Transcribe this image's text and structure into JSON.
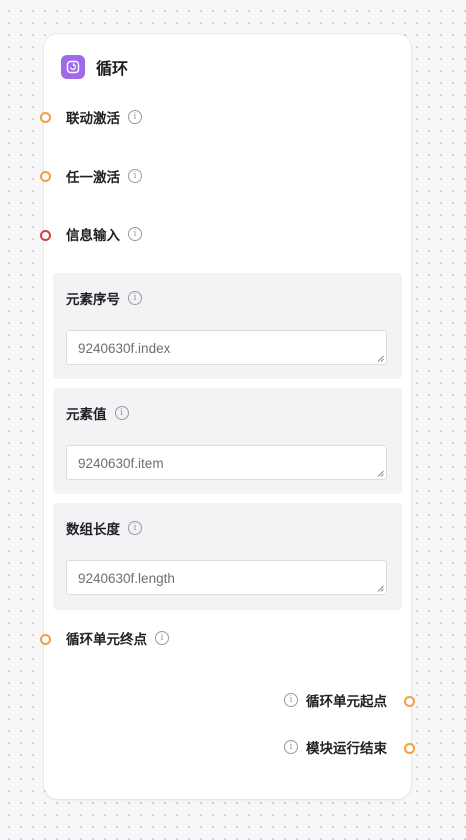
{
  "node": {
    "title": "循环",
    "icon": "loop-icon",
    "accent_color": "#a069e8"
  },
  "inputs": [
    {
      "label": "联动激活",
      "port_color": "#f0a040"
    },
    {
      "label": "任一激活",
      "port_color": "#f0a040"
    },
    {
      "label": "信息输入",
      "port_color": "#d84040"
    }
  ],
  "sections": [
    {
      "label": "元素序号",
      "value": "9240630f.index"
    },
    {
      "label": "元素值",
      "value": "9240630f.item"
    },
    {
      "label": "数组长度",
      "value": "9240630f.length"
    }
  ],
  "loop_end": {
    "label": "循环单元终点"
  },
  "outputs": [
    {
      "label": "循环单元起点"
    },
    {
      "label": "模块运行结束"
    }
  ],
  "info_glyph": "i"
}
